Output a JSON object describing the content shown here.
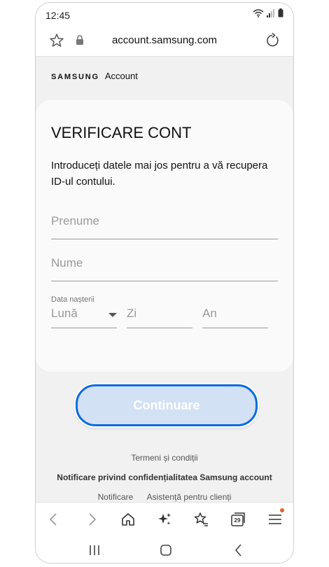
{
  "status_bar": {
    "time": "12:45"
  },
  "browser": {
    "url": "account.samsung.com"
  },
  "brand": {
    "samsung": "SAMSUNG",
    "account": "Account"
  },
  "card": {
    "title": "VERIFICARE CONT",
    "description": "Introduceți datele mai jos pentru a vă recupera ID-ul contului.",
    "first_name_placeholder": "Prenume",
    "last_name_placeholder": "Nume",
    "dob_label": "Data nașterii",
    "month_value": "Lună",
    "day_placeholder": "Zi",
    "year_placeholder": "An"
  },
  "continue_label": "Continuare",
  "footer": {
    "terms": "Termeni și condiții",
    "privacy": "Notificare privind confidențialitatea Samsung account",
    "link_notice": "Notificare",
    "link_support": "Asistență pentru clienți"
  },
  "toolbar": {
    "tabs_count": "29"
  },
  "colors": {
    "accent": "#0b6be0",
    "button_fill": "#d3e1f5",
    "badge_dot": "#e8612c"
  }
}
